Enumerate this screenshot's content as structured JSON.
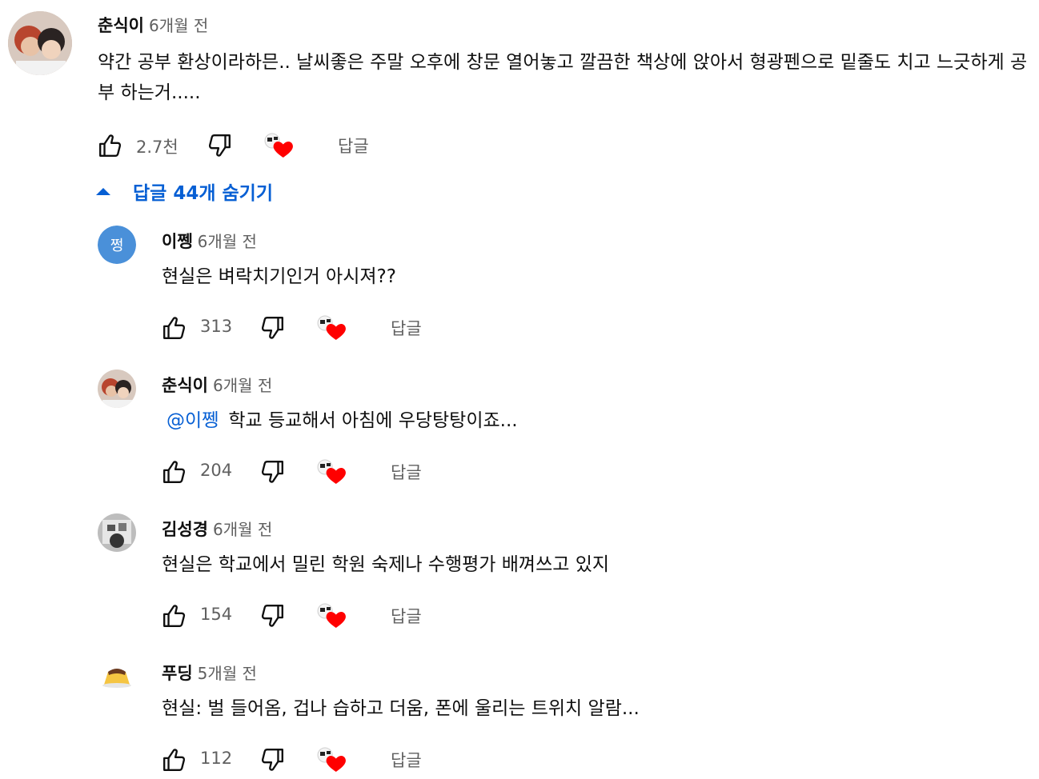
{
  "thread": {
    "top": {
      "author": "춘식이",
      "time": "6개월 전",
      "text": "약간 공부 환상이라하믄.. 날씨좋은 주말 오후에 창문 열어놓고 깔끔한 책상에 앉아서 형광펜으로 밑줄도 치고 느긋하게 공부 하는거.....",
      "likes": "2.7천",
      "reply_label": "답글"
    },
    "replies_toggle": {
      "label": "답글 44개 숨기기"
    },
    "replies": [
      {
        "author": "이쩽",
        "time": "6개월 전",
        "mention": "",
        "text": "현실은 벼락치기인거 아시져??",
        "likes": "313",
        "reply_label": "답글",
        "avatar_letter": "쩡",
        "avatar_color": "#4a90d9"
      },
      {
        "author": "춘식이",
        "time": "6개월 전",
        "mention": "@이쩽",
        "text": "학교 등교해서 아침에 우당탕탕이죠...",
        "likes": "204",
        "reply_label": "답글"
      },
      {
        "author": "김성경",
        "time": "6개월 전",
        "mention": "",
        "text": "현실은 학교에서 밀린 학원 숙제나 수행평가 배껴쓰고 있지",
        "likes": "154",
        "reply_label": "답글"
      },
      {
        "author": "푸딩",
        "time": "5개월 전",
        "mention": "",
        "text": "현실: 벌 들어옴, 겁나 습하고 더움, 폰에 울리는 트위치 알람...",
        "likes": "112",
        "reply_label": "답글"
      }
    ]
  },
  "colors": {
    "link": "#065fd4",
    "secondary_text": "#606060",
    "heart": "#ff0000"
  }
}
